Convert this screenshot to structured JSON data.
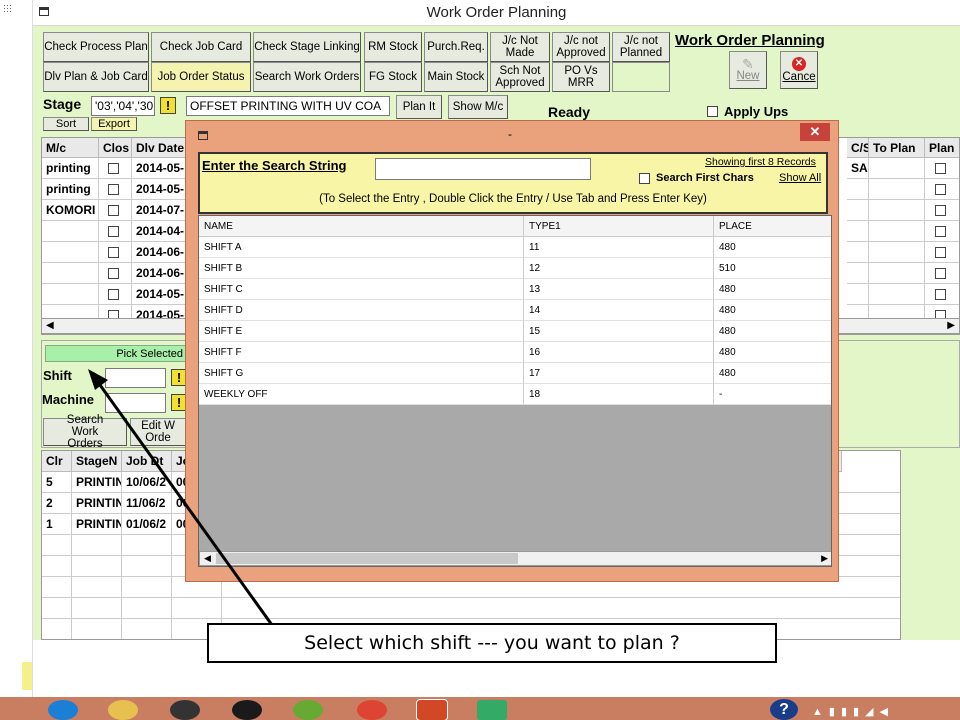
{
  "window": {
    "title": "Work Order Planning"
  },
  "toolbar": {
    "row1": [
      "Check Process Plan",
      "Check Job Card",
      "Check Stage Linking",
      "RM Stock",
      "Purch.Req.",
      "J/c Not Made",
      "J/c not Approved",
      "J/c not Planned"
    ],
    "row2": [
      "Dlv Plan & Job Card",
      "Job Order Status",
      "Search Work Orders",
      "FG Stock",
      "Main Stock",
      "Sch Not Approved",
      "PO Vs MRR"
    ],
    "section_title": "Work Order Planning",
    "new_label": "New",
    "cancel_label": "Cance"
  },
  "stage": {
    "label": "Stage",
    "value": "'03','04','30",
    "process_value": "OFFSET PRINTING WITH UV COA",
    "plan_it": "Plan It",
    "show_mc": "Show M/c",
    "status": "Ready",
    "apply_ups": "Apply Ups",
    "sort": "Sort",
    "export": "Export"
  },
  "top_grid": {
    "headers": [
      "M/c",
      "Clos",
      "Dlv Date"
    ],
    "right_headers": [
      "C/S",
      "To Plan",
      "Plan"
    ],
    "rows": [
      {
        "mc": "printing",
        "date": "2014-05-",
        "cs": "SA"
      },
      {
        "mc": "printing",
        "date": "2014-05-",
        "cs": ""
      },
      {
        "mc": "KOMORI",
        "date": "2014-07-",
        "cs": ""
      },
      {
        "mc": "",
        "date": "2014-04-",
        "cs": ""
      },
      {
        "mc": "",
        "date": "2014-06-",
        "cs": ""
      },
      {
        "mc": "",
        "date": "2014-06-",
        "cs": ""
      },
      {
        "mc": "",
        "date": "2014-05-",
        "cs": ""
      },
      {
        "mc": "",
        "date": "2014-05-",
        "cs": ""
      }
    ]
  },
  "lower_panel": {
    "pick_selected": "Pick Selected",
    "shift_label": "Shift",
    "machine_label": "Machine",
    "search_work_orders": "Search Work Orders",
    "edit_work_orders": "Edit W Orde"
  },
  "bottom_grid": {
    "headers": [
      "Clr",
      "StageN",
      "Job Dt",
      "Jo"
    ],
    "rows": [
      {
        "clr": "5",
        "stage": "PRINTIN",
        "dt": "10/06/2",
        "jo": "00"
      },
      {
        "clr": "2",
        "stage": "PRINTIN",
        "dt": "11/06/2",
        "jo": "00"
      },
      {
        "clr": "1",
        "stage": "PRINTIN",
        "dt": "01/06/2",
        "jo": "00"
      }
    ]
  },
  "dialog": {
    "title": "-",
    "close": "✕",
    "search_label": "Enter the Search String",
    "search_value": "",
    "showing": "Showing first 8 Records",
    "search_first_chars": "Search First Chars",
    "show_all": "Show All",
    "hint": "(To Select the Entry , Double Click the Entry / Use Tab and Press Enter Key)",
    "columns": [
      "NAME",
      "TYPE1",
      "PLACE"
    ],
    "rows": [
      {
        "name": "SHIFT A",
        "type1": "11",
        "place": "480"
      },
      {
        "name": "SHIFT B",
        "type1": "12",
        "place": "510"
      },
      {
        "name": "SHIFT C",
        "type1": "13",
        "place": "480"
      },
      {
        "name": "SHIFT D",
        "type1": "14",
        "place": "480"
      },
      {
        "name": "SHIFT E",
        "type1": "15",
        "place": "480"
      },
      {
        "name": "SHIFT F",
        "type1": "16",
        "place": "480"
      },
      {
        "name": "SHIFT G",
        "type1": "17",
        "place": "480"
      },
      {
        "name": "WEEKLY OFF",
        "type1": "18",
        "place": "-"
      }
    ]
  },
  "callout": {
    "text": "Select which shift --- you want to plan ?"
  },
  "taskbar": {
    "icons": [
      "ie-icon",
      "folder-icon",
      "media-icon",
      "hp-icon",
      "puzzle-icon",
      "chrome-icon",
      "powerpoint-icon",
      "notepad-icon"
    ],
    "help": "?"
  }
}
